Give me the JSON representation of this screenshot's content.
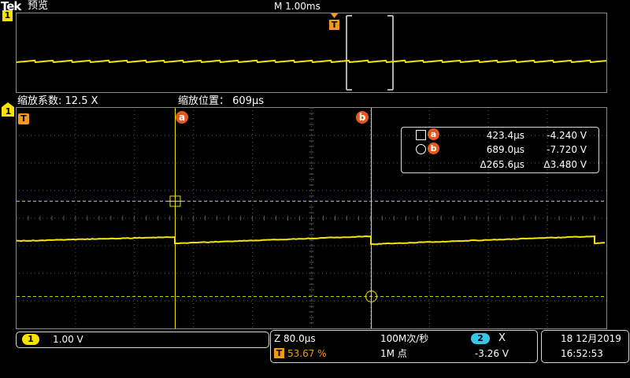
{
  "header": {
    "brand": "Tek",
    "mode": "预览",
    "timebase": "M 1.00ms",
    "zoom_factor_label": "缩放系数:",
    "zoom_factor_value": "12.5 X",
    "zoom_position_label": "缩放位置：",
    "zoom_position_value": "609μs"
  },
  "markers": {
    "channel1": "1",
    "trigger": "T",
    "cursor_a": "a",
    "cursor_b": "b"
  },
  "cursor_readout": {
    "a_time": "423.4μs",
    "a_volt": "-4.240 V",
    "b_time": "689.0μs",
    "b_volt": "-7.720 V",
    "delta_time": "Δ265.6μs",
    "delta_volt": "Δ3.480 V"
  },
  "status_bar": {
    "ch1_badge": "1",
    "ch1_scale": "1.00 V",
    "zoom_scale": "Z 80.0μs",
    "trigger_pos_icon": "T",
    "trigger_pos": "53.67 %",
    "sample_rate": "100M次/秒",
    "record_length": "1M 点",
    "ch2_badge": "2",
    "trigger_slope_symbol": "X",
    "trigger_level": "-3.26 V",
    "date": "18 12月2019",
    "time": "16:52:53"
  },
  "colors": {
    "trace": "#f6e400",
    "cursor_badge": "#e8581c",
    "trigger_marker": "#f39a1e",
    "ch2_badge": "#36c6e6"
  }
}
